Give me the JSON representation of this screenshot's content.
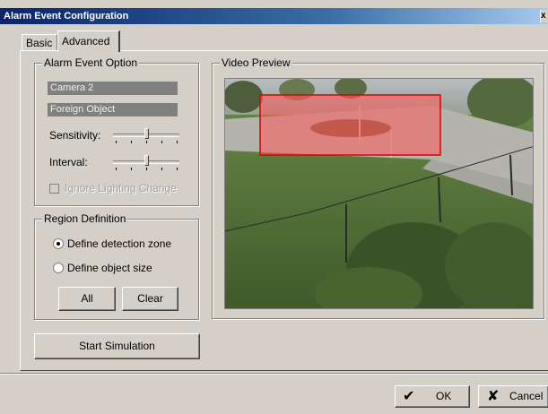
{
  "window": {
    "title": "Alarm Event Configuration",
    "close_glyph": "x"
  },
  "tabs": [
    {
      "label": "Basic",
      "active": false
    },
    {
      "label": "Advanced",
      "active": true
    }
  ],
  "alarm_event_option": {
    "legend": "Alarm Event Option",
    "camera": "Camera 2",
    "event_type": "Foreign Object",
    "sensitivity_label": "Sensitivity:",
    "sensitivity_level": 0.5,
    "interval_label": "Interval:",
    "interval_level": 0.5,
    "ignore_lighting_label": "Ignore Lighting Change",
    "ignore_lighting_checked": false,
    "ignore_lighting_enabled": false
  },
  "region_definition": {
    "legend": "Region Definition",
    "options": [
      {
        "label": "Define detection zone",
        "selected": true
      },
      {
        "label": "Define object size",
        "selected": false
      }
    ],
    "all_label": "All",
    "clear_label": "Clear"
  },
  "start_simulation_label": "Start Simulation",
  "video_preview": {
    "legend": "Video Preview",
    "detection_zone_color": "#ff0000"
  },
  "footer": {
    "ok_label": "OK",
    "cancel_label": "Cancel"
  },
  "icons": {
    "ok": "checkmark-icon",
    "cancel": "x-icon"
  }
}
